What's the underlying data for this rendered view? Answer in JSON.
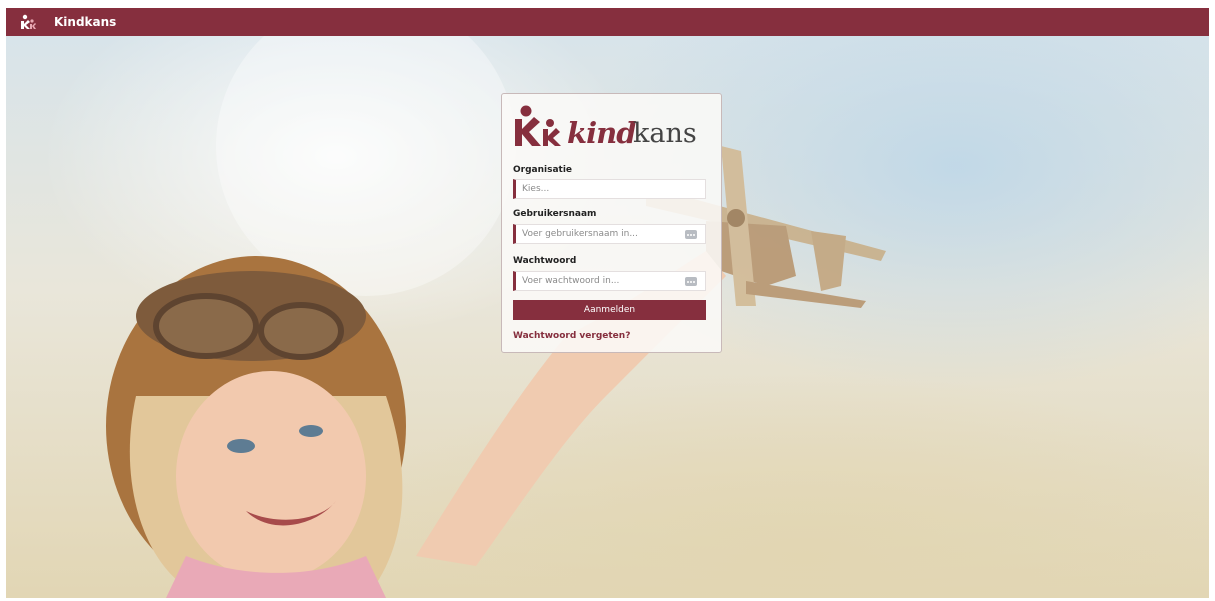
{
  "app": {
    "title": "Kindkans",
    "brand_color": "#862f3e"
  },
  "brand": {
    "word_bold": "kind",
    "word_light": "kans"
  },
  "form": {
    "organisation": {
      "label": "Organisatie",
      "placeholder": "Kies..."
    },
    "username": {
      "label": "Gebruikersnaam",
      "placeholder": "Voer gebruikersnaam in...",
      "icon": "more-dots-icon"
    },
    "password": {
      "label": "Wachtwoord",
      "placeholder": "Voer wachtwoord in...",
      "icon": "more-dots-icon"
    },
    "submit_label": "Aanmelden",
    "forgot_label": "Wachtwoord vergeten?"
  },
  "background": {
    "subject": "child-with-toy-airplane-photo"
  }
}
